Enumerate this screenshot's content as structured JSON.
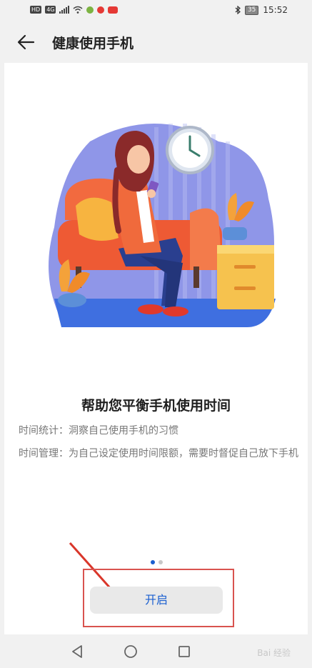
{
  "status_bar": {
    "left_badges": [
      "HD",
      "4G"
    ],
    "time": "15:52",
    "battery": "35",
    "icons": [
      "hd-icon",
      "signal-icon",
      "wifi-icon",
      "app-notification-icon",
      "bluetooth-icon",
      "battery-icon"
    ]
  },
  "header": {
    "title": "健康使用手机",
    "back_icon": "arrow-left-icon"
  },
  "main": {
    "headline": "帮助您平衡手机使用时间",
    "desc_stats": "时间统计：洞察自己使用手机的习惯",
    "desc_manage": "时间管理：为自己设定使用时间限额，需要时督促自己放下手机",
    "pager": {
      "count": 2,
      "active": 1
    },
    "start_button": "开启"
  },
  "navbar": {
    "icons": [
      "back-triangle-icon",
      "home-circle-icon",
      "recents-square-icon"
    ]
  },
  "watermark": "Bai 经验",
  "colors": {
    "accent": "#1a5fd0",
    "highlight": "#d9534f",
    "background": "#f1f1f1"
  }
}
